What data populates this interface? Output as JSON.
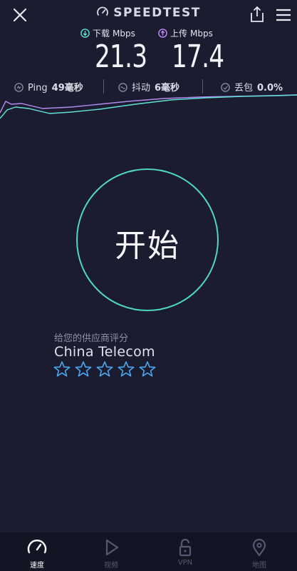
{
  "header": {
    "brand": "SPEEDTEST"
  },
  "download": {
    "label": "下载",
    "unit": "Mbps",
    "value": "21.3"
  },
  "upload": {
    "label": "上传",
    "unit": "Mbps",
    "value": "17.4"
  },
  "stats": {
    "ping": {
      "label": "Ping",
      "value": "49毫秒"
    },
    "jitter": {
      "label": "抖动",
      "value": "6毫秒"
    },
    "loss": {
      "label": "丢包",
      "value": "0.0%"
    }
  },
  "start_button": {
    "label": "开始"
  },
  "rating": {
    "prompt": "给您的供应商评分",
    "provider": "China Telecom",
    "max_stars": 5,
    "selected_stars": 0
  },
  "nav": {
    "items": [
      {
        "label": "速度",
        "icon": "speedometer-icon",
        "active": true
      },
      {
        "label": "视频",
        "icon": "play-icon",
        "active": false
      },
      {
        "label": "VPN",
        "icon": "lock-icon",
        "active": false
      },
      {
        "label": "地图",
        "icon": "map-pin-icon",
        "active": false
      }
    ]
  },
  "colors": {
    "background": "#1b1c30",
    "download_accent": "#5fe2d7",
    "upload_accent": "#c38bff",
    "start_ring": "#4fd8c7",
    "star": "#4aa8f0",
    "nav_background": "#141524"
  }
}
